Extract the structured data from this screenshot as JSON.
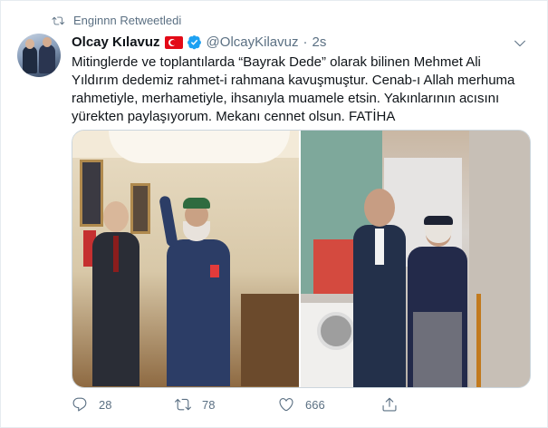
{
  "retweet": {
    "text": "Enginnn Retweetledi"
  },
  "tweet": {
    "author_name": "Olcay Kılavuz",
    "author_handle": "@OlcayKilavuz",
    "separator": "·",
    "time": "2s",
    "text": "Mitinglerde ve toplantılarda “Bayrak Dede” olarak bilinen Mehmet Ali Yıldırım dedemiz rahmet-i rahmana kavuşmuştur. Cenab-ı Allah merhuma rahmetiyle, merhametiyle, ihsanıyla muamele etsin. Yakınlarının acısını yürekten paylaşıyorum. Mekanı cennet olsun. FATİHA"
  },
  "actions": {
    "reply_count": "28",
    "retweet_count": "78",
    "like_count": "666"
  },
  "icons": [
    "retweet-icon",
    "verified-badge-icon",
    "turkish-flag-icon",
    "chevron-down-icon",
    "reply-icon",
    "like-icon",
    "share-icon"
  ],
  "colors": {
    "secondary_text": "#5b7083",
    "verified_blue": "#1da1f2",
    "flag_red": "#e30a17",
    "border": "#e6ecf0"
  }
}
